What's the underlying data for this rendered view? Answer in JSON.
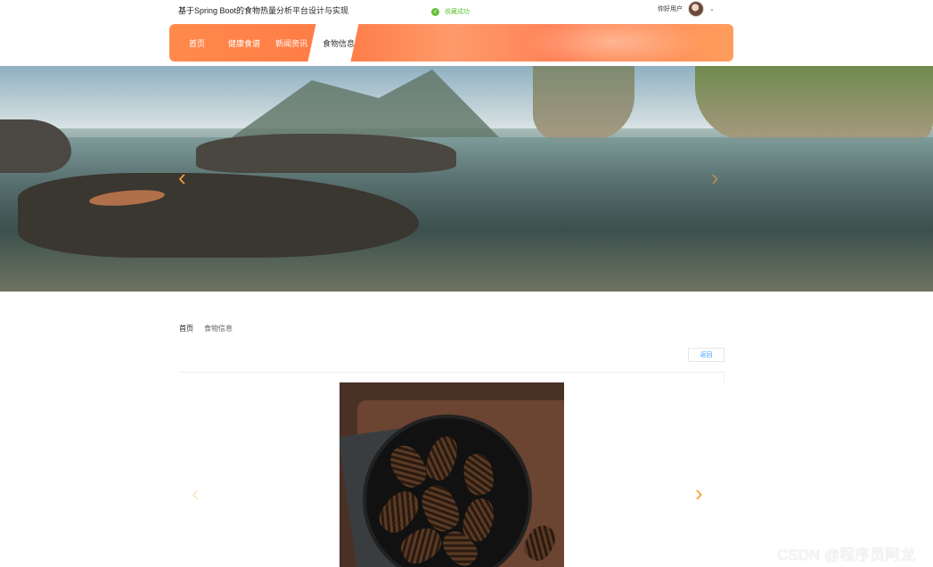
{
  "header": {
    "site_title": "基于Spring Boot的食物热量分析平台设计与实现",
    "toast": "收藏成功",
    "user_name": "你好用户",
    "user_menu_icon": "chevron-down-icon"
  },
  "nav": {
    "items": [
      {
        "label": "首页"
      },
      {
        "label": "健康食谱"
      },
      {
        "label": "新闻资讯"
      },
      {
        "label": "食物信息"
      }
    ],
    "active": "食物信息",
    "accent_color": "#ff8a4c"
  },
  "banner": {
    "prev_icon": "chevron-left-icon",
    "next_icon": "chevron-right-icon"
  },
  "breadcrumb": {
    "home": "首页",
    "current": "食物信息"
  },
  "detail": {
    "back_label": "返回",
    "prev_icon": "chevron-left-icon",
    "next_icon": "chevron-right-icon"
  },
  "watermark": "CSDN @程序员阿龙"
}
